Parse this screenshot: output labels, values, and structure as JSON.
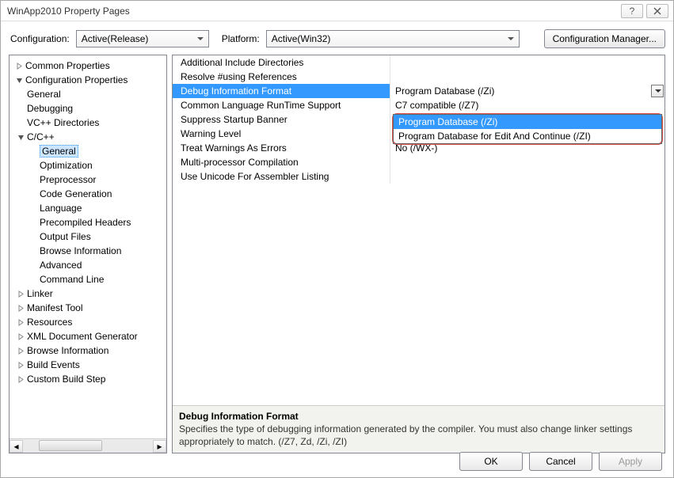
{
  "window": {
    "title": "WinApp2010 Property Pages"
  },
  "config": {
    "configuration_label": "Configuration:",
    "configuration_value": "Active(Release)",
    "platform_label": "Platform:",
    "platform_value": "Active(Win32)",
    "cfg_manager": "Configuration Manager..."
  },
  "tree": {
    "common_properties": "Common Properties",
    "configuration_properties": "Configuration Properties",
    "general": "General",
    "debugging": "Debugging",
    "vcpp_directories": "VC++ Directories",
    "ccpp": "C/C++",
    "ccpp_general": "General",
    "optimization": "Optimization",
    "preprocessor": "Preprocessor",
    "code_generation": "Code Generation",
    "language": "Language",
    "precompiled_headers": "Precompiled Headers",
    "output_files": "Output Files",
    "browse_information": "Browse Information",
    "advanced": "Advanced",
    "command_line": "Command Line",
    "linker": "Linker",
    "manifest_tool": "Manifest Tool",
    "resources": "Resources",
    "xml_doc_gen": "XML Document Generator",
    "browse_information2": "Browse Information",
    "build_events": "Build Events",
    "custom_build_step": "Custom Build Step"
  },
  "props": {
    "additional_include_dirs": {
      "name": "Additional Include Directories",
      "value": ""
    },
    "resolve_using": {
      "name": "Resolve #using References",
      "value": ""
    },
    "debug_info_format": {
      "name": "Debug Information Format",
      "value": "Program Database (/Zi)"
    },
    "clr_support": {
      "name": "Common Language RunTime Support",
      "value": "C7 compatible (/Z7)"
    },
    "suppress_startup_banner": {
      "name": "Suppress Startup Banner",
      "value": ""
    },
    "warning_level": {
      "name": "Warning Level",
      "value": ""
    },
    "treat_warnings_as_errors": {
      "name": "Treat Warnings As Errors",
      "value": "No (/WX-)"
    },
    "multi_processor": {
      "name": "Multi-processor Compilation",
      "value": ""
    },
    "use_unicode_asm": {
      "name": "Use Unicode For Assembler Listing",
      "value": ""
    }
  },
  "dropdown": {
    "opt1": "Program Database (/Zi)",
    "opt2": "Program Database for Edit And Continue (/ZI)"
  },
  "info": {
    "title": "Debug Information Format",
    "desc": "Specifies the type of debugging information generated by the compiler.  You must also change linker settings appropriately to match.     (/Z7, Zd, /Zi, /ZI)"
  },
  "buttons": {
    "ok": "OK",
    "cancel": "Cancel",
    "apply": "Apply"
  }
}
